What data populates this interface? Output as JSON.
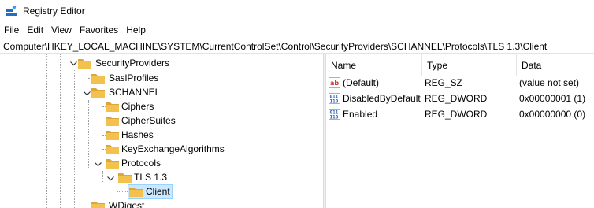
{
  "window": {
    "title": "Registry Editor"
  },
  "menu": [
    "File",
    "Edit",
    "View",
    "Favorites",
    "Help"
  ],
  "address": {
    "path": "Computer\\HKEY_LOCAL_MACHINE\\SYSTEM\\CurrentControlSet\\Control\\SecurityProviders\\SCHANNEL\\Protocols\\TLS 1.3\\Client"
  },
  "tree": {
    "items": [
      {
        "label": "SecurityProviders",
        "state": "expanded"
      },
      {
        "label": "SaslProfiles",
        "state": "leaf"
      },
      {
        "label": "SCHANNEL",
        "state": "expanded"
      },
      {
        "label": "Ciphers",
        "state": "leaf"
      },
      {
        "label": "CipherSuites",
        "state": "leaf"
      },
      {
        "label": "Hashes",
        "state": "leaf"
      },
      {
        "label": "KeyExchangeAlgorithms",
        "state": "leaf"
      },
      {
        "label": "Protocols",
        "state": "expanded"
      },
      {
        "label": "TLS 1.3",
        "state": "expanded"
      },
      {
        "label": "Client",
        "state": "selected"
      },
      {
        "label": "WDigest",
        "state": "leaf"
      }
    ]
  },
  "list": {
    "columns": [
      "Name",
      "Type",
      "Data"
    ],
    "rows": [
      {
        "icon": "string-value-icon",
        "name": "(Default)",
        "type": "REG_SZ",
        "data": "(value not set)"
      },
      {
        "icon": "binary-value-icon",
        "name": "DisabledByDefault",
        "type": "REG_DWORD",
        "data": "0x00000001 (1)"
      },
      {
        "icon": "binary-value-icon",
        "name": "Enabled",
        "type": "REG_DWORD",
        "data": "0x00000000 (0)"
      }
    ]
  },
  "colors": {
    "folder": "#f2c14e",
    "folder_dark": "#dca63a",
    "selection": "#cce8ff",
    "selection_border": "#99d1ff"
  }
}
